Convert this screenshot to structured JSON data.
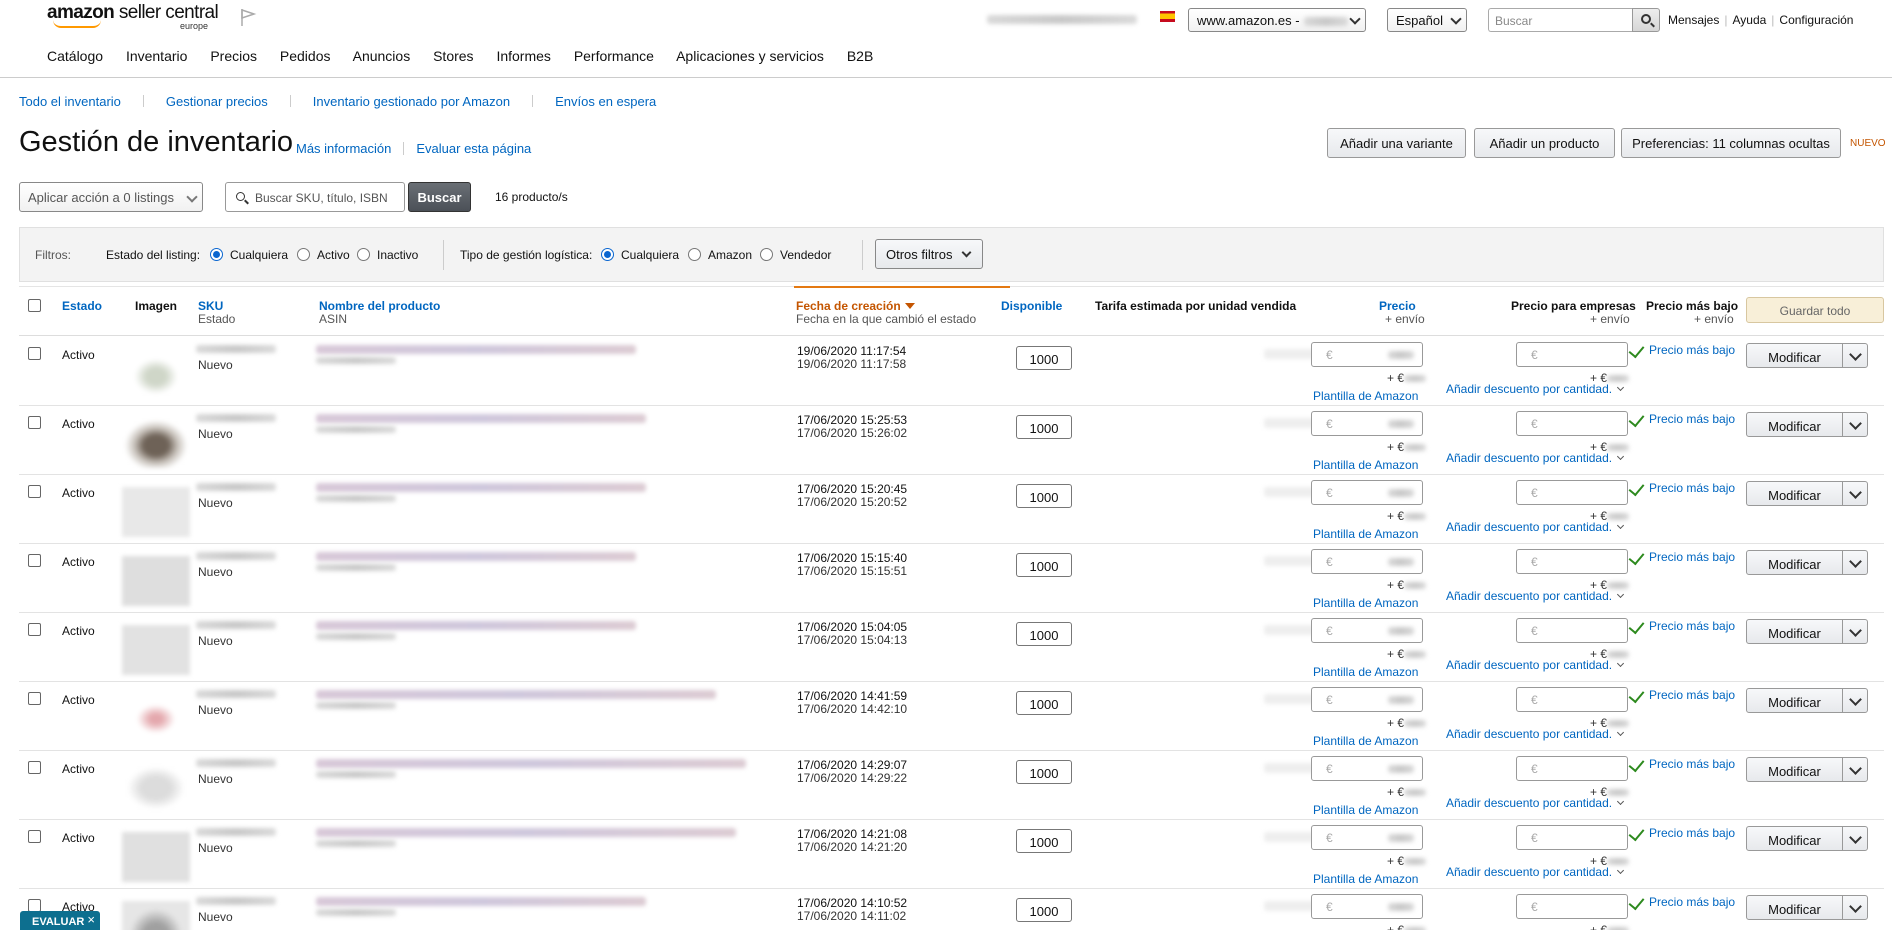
{
  "header": {
    "logo_main": "amazon seller central",
    "logo_word1": "amazon",
    "logo_word2": "seller central",
    "logo_sub": "europe",
    "marketplace": "www.amazon.es -",
    "language": "Español",
    "search_placeholder": "Buscar",
    "links": [
      "Mensajes",
      "Ayuda",
      "Configuración"
    ]
  },
  "nav": [
    "Catálogo",
    "Inventario",
    "Precios",
    "Pedidos",
    "Anuncios",
    "Stores",
    "Informes",
    "Performance",
    "Aplicaciones y servicios",
    "B2B"
  ],
  "subnav": [
    "Todo el inventario",
    "Gestionar precios",
    "Inventario gestionado por Amazon",
    "Envíos en espera"
  ],
  "page": {
    "title": "Gestión de inventario",
    "more_info": "Más información",
    "rate_page": "Evaluar esta página",
    "btn_variant": "Añadir una variante",
    "btn_product": "Añadir un producto",
    "btn_prefs": "Preferencias: 11 columnas ocultas",
    "new_badge": "NUEVO",
    "bulk_action": "Aplicar acción a 0 listings",
    "search_placeholder": "Buscar SKU, título, ISBN",
    "search_btn": "Buscar",
    "count": "16 producto/s"
  },
  "filters": {
    "label": "Filtros:",
    "listing_label": "Estado del listing:",
    "listing_options": [
      "Cualquiera",
      "Activo",
      "Inactivo"
    ],
    "logistics_label": "Tipo de gestión logística:",
    "logistics_options": [
      "Cualquiera",
      "Amazon",
      "Vendedor"
    ],
    "more": "Otros filtros"
  },
  "table": {
    "headers": {
      "estado": "Estado",
      "imagen": "Imagen",
      "sku": "SKU",
      "sku_sub": "Estado",
      "name": "Nombre del producto",
      "name_sub": "ASIN",
      "created": "Fecha de creación",
      "created_sub": "Fecha en la que cambió el estado",
      "available": "Disponible",
      "fee": "Tarifa estimada por unidad vendida",
      "price": "Precio",
      "price_sub": "+ envío",
      "biz_price": "Precio para empresas",
      "biz_sub": "+ envío",
      "lowest": "Precio más bajo",
      "lowest_sub": "+ envío",
      "save_all": "Guardar todo"
    },
    "row_labels": {
      "currency": "€",
      "ship_prefix": "+ €",
      "template": "Plantilla de Amazon",
      "discount": "Añadir descuento por cantidad.",
      "lowest_link": "Precio más bajo",
      "modify": "Modificar"
    },
    "rows": [
      {
        "status": "Activo",
        "condition": "Nuevo",
        "created": "19/06/2020 11:17:54",
        "changed": "19/06/2020 11:17:58",
        "qty": "1000"
      },
      {
        "status": "Activo",
        "condition": "Nuevo",
        "created": "17/06/2020 15:25:53",
        "changed": "17/06/2020 15:26:02",
        "qty": "1000"
      },
      {
        "status": "Activo",
        "condition": "Nuevo",
        "created": "17/06/2020 15:20:45",
        "changed": "17/06/2020 15:20:52",
        "qty": "1000"
      },
      {
        "status": "Activo",
        "condition": "Nuevo",
        "created": "17/06/2020 15:15:40",
        "changed": "17/06/2020 15:15:51",
        "qty": "1000"
      },
      {
        "status": "Activo",
        "condition": "Nuevo",
        "created": "17/06/2020 15:04:05",
        "changed": "17/06/2020 15:04:13",
        "qty": "1000"
      },
      {
        "status": "Activo",
        "condition": "Nuevo",
        "created": "17/06/2020 14:41:59",
        "changed": "17/06/2020 14:42:10",
        "qty": "1000"
      },
      {
        "status": "Activo",
        "condition": "Nuevo",
        "created": "17/06/2020 14:29:07",
        "changed": "17/06/2020 14:29:22",
        "qty": "1000"
      },
      {
        "status": "Activo",
        "condition": "Nuevo",
        "created": "17/06/2020 14:21:08",
        "changed": "17/06/2020 14:21:20",
        "qty": "1000"
      },
      {
        "status": "Activo",
        "condition": "Nuevo",
        "created": "17/06/2020 14:10:52",
        "changed": "17/06/2020 14:11:02",
        "qty": "1000"
      }
    ]
  },
  "feedback": {
    "label": "EVALUAR",
    "close": "×"
  },
  "colors": {
    "link": "#0066c0",
    "sort": "#c45500",
    "accent": "#f90",
    "check": "#2d8a1e",
    "feedback": "#0d6f8f"
  }
}
